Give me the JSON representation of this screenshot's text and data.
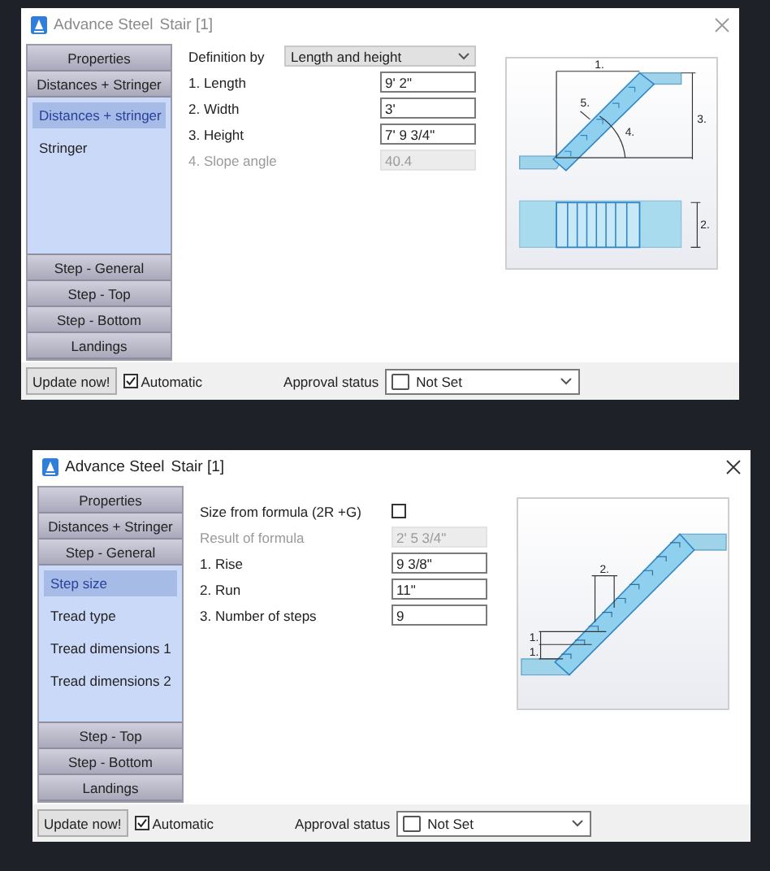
{
  "dialogs": [
    {
      "active": false,
      "app_name": "Advance Steel",
      "document": "Stair [1]",
      "nav": {
        "top_sections": [
          "Properties",
          "Distances + Stringer"
        ],
        "items": [
          {
            "label": "Distances + stringer",
            "selected": true
          },
          {
            "label": "Stringer",
            "selected": false
          }
        ],
        "bottom_sections": [
          "Step - General",
          "Step - Top",
          "Step - Bottom",
          "Landings"
        ]
      },
      "fields": [
        {
          "kind": "select",
          "label": "Definition by",
          "value": "Length and height"
        },
        {
          "kind": "input",
          "label": "1. Length",
          "value": "9' 2\"",
          "disabled": false
        },
        {
          "kind": "input",
          "label": "2. Width",
          "value": "3'",
          "disabled": false
        },
        {
          "kind": "input",
          "label": "3. Height",
          "value": "7' 9 3/4\"",
          "disabled": false
        },
        {
          "kind": "input",
          "label": "4. Slope angle",
          "value": "40.4",
          "disabled": true
        }
      ],
      "diagram": {
        "kind": "stair-elevation-plan",
        "labels": [
          "1.",
          "3.",
          "4.",
          "5.",
          "2."
        ]
      },
      "footer": {
        "update_button": "Update now!",
        "automatic": {
          "label": "Automatic",
          "checked": true
        },
        "approval_label": "Approval status",
        "approval_value": "Not Set"
      }
    },
    {
      "active": true,
      "app_name": "Advance Steel",
      "document": "Stair [1]",
      "nav": {
        "top_sections": [
          "Properties",
          "Distances + Stringer",
          "Step - General"
        ],
        "items": [
          {
            "label": "Step size",
            "selected": true
          },
          {
            "label": "Tread type",
            "selected": false
          },
          {
            "label": "Tread dimensions 1",
            "selected": false
          },
          {
            "label": "Tread dimensions 2",
            "selected": false
          }
        ],
        "bottom_sections": [
          "Step - Top",
          "Step - Bottom",
          "Landings"
        ]
      },
      "fields": [
        {
          "kind": "checkbox",
          "label": "Size from formula (2R +G)",
          "checked": false
        },
        {
          "kind": "input",
          "label": "Result of formula",
          "value": "2' 5 3/4\"",
          "disabled": true
        },
        {
          "kind": "input",
          "label": "1. Rise",
          "value": "9 3/8\"",
          "disabled": false
        },
        {
          "kind": "input",
          "label": "2. Run",
          "value": "11\"",
          "disabled": false
        },
        {
          "kind": "input",
          "label": "3. Number of steps",
          "value": "9",
          "disabled": false
        }
      ],
      "diagram": {
        "kind": "stair-steps",
        "labels": [
          "2.",
          "1.",
          "1."
        ]
      },
      "footer": {
        "update_button": "Update now!",
        "automatic": {
          "label": "Automatic",
          "checked": true
        },
        "approval_label": "Approval status",
        "approval_value": "Not Set"
      }
    }
  ]
}
